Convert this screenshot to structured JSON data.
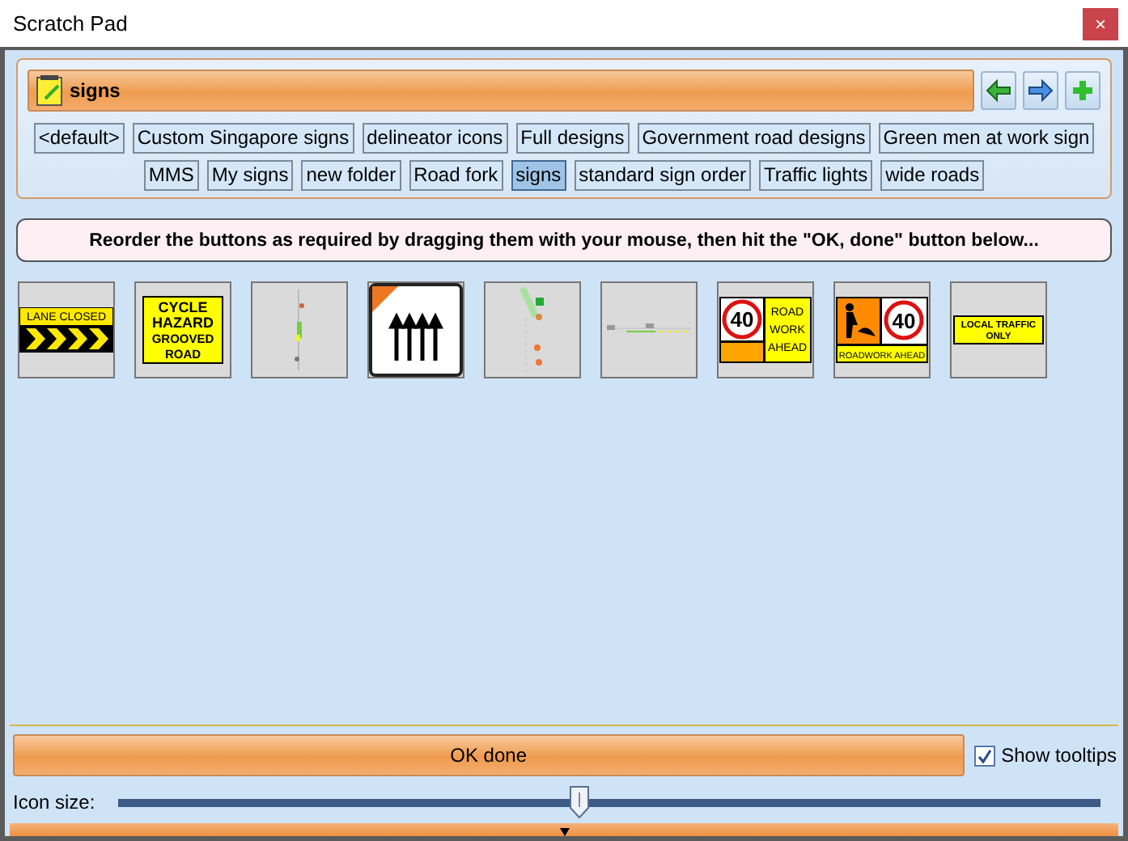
{
  "window": {
    "title": "Scratch Pad",
    "close": "×"
  },
  "header": {
    "folder": "signs"
  },
  "folders": [
    {
      "label": "<default>",
      "selected": false
    },
    {
      "label": "Custom Singapore signs",
      "selected": false
    },
    {
      "label": "delineator icons",
      "selected": false
    },
    {
      "label": "Full designs",
      "selected": false
    },
    {
      "label": "Government road designs",
      "selected": false
    },
    {
      "label": "Green men at work sign",
      "selected": false
    },
    {
      "label": "MMS",
      "selected": false
    },
    {
      "label": "My signs",
      "selected": false
    },
    {
      "label": "new folder",
      "selected": false
    },
    {
      "label": "Road fork",
      "selected": false
    },
    {
      "label": "signs",
      "selected": true
    },
    {
      "label": "standard sign order",
      "selected": false
    },
    {
      "label": "Traffic lights",
      "selected": false
    },
    {
      "label": "wide roads",
      "selected": false
    }
  ],
  "instruction": "Reorder the buttons as required by dragging them with your mouse, then hit the \"OK, done\" button below...",
  "tiles": [
    {
      "kind": "chevron",
      "lines": [
        "LANE CLOSED"
      ]
    },
    {
      "kind": "text",
      "lines": [
        "CYCLE",
        "HAZARD",
        "GROOVED",
        "ROAD"
      ]
    },
    {
      "kind": "diagram"
    },
    {
      "kind": "arrows"
    },
    {
      "kind": "diagram-green"
    },
    {
      "kind": "diagram-wide"
    },
    {
      "kind": "speed-text",
      "lines": [
        "40",
        "ROAD",
        "WORK",
        "AHEAD"
      ]
    },
    {
      "kind": "worker-speed",
      "lines": [
        "40",
        "ROADWORK AHEAD"
      ]
    },
    {
      "kind": "banner",
      "lines": [
        "LOCAL TRAFFIC",
        "ONLY"
      ]
    }
  ],
  "ok_button": "OK done",
  "show_tooltips": {
    "label": "Show tooltips",
    "checked": true
  },
  "icon_size": {
    "label": "Icon size:",
    "level": 0.47
  }
}
